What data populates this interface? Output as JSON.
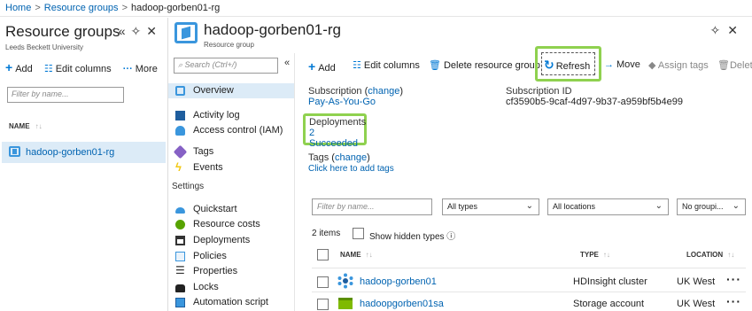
{
  "breadcrumb": {
    "home": "Home",
    "resource_groups": "Resource groups",
    "current": "hadoop-gorben01-rg"
  },
  "left_blade": {
    "title": "Resource groups",
    "subtitle": "Leeds Beckett University",
    "actions": [
      "«",
      "pin-icon",
      "close-icon"
    ],
    "toolbar": {
      "add": "Add",
      "edit_columns": "Edit columns",
      "more": "More"
    },
    "filter_placeholder": "Filter by name...",
    "column_name": "NAME",
    "rows": [
      {
        "name": "hadoop-gorben01-rg"
      }
    ]
  },
  "resource_blade": {
    "title": "hadoop-gorben01-rg",
    "subtitle": "Resource group",
    "search_placeholder": "Search (Ctrl+/)",
    "collapse": "«",
    "menu": [
      {
        "label": "Overview",
        "icon": "resource-group-icon",
        "active": true
      },
      {
        "label": "Activity log",
        "icon": "activity-log-icon"
      },
      {
        "label": "Access control (IAM)",
        "icon": "people-icon"
      },
      {
        "label": "Tags",
        "icon": "tag-icon"
      },
      {
        "label": "Events",
        "icon": "lightning-icon"
      }
    ],
    "settings_header": "Settings",
    "settings_menu": [
      {
        "label": "Quickstart",
        "icon": "cloud-icon"
      },
      {
        "label": "Resource costs",
        "icon": "coin-icon"
      },
      {
        "label": "Deployments",
        "icon": "deployments-icon"
      },
      {
        "label": "Policies",
        "icon": "policy-icon"
      },
      {
        "label": "Properties",
        "icon": "list-icon"
      },
      {
        "label": "Locks",
        "icon": "lock-icon"
      },
      {
        "label": "Automation script",
        "icon": "script-icon"
      }
    ],
    "toolbar": {
      "add": "Add",
      "edit_columns": "Edit columns",
      "delete": "Delete resource group",
      "refresh": "Refresh",
      "move": "Move",
      "assign_tags": "Assign tags",
      "delete_short": "Delete"
    },
    "essentials": {
      "subscription_label": "Subscription",
      "subscription_change": "change",
      "subscription_value": "Pay-As-You-Go",
      "subscription_id_label": "Subscription ID",
      "subscription_id_value": "cf3590b5-9caf-4d97-9b37-a959bf5b4e99",
      "deployments_label": "Deployments",
      "deployments_value": "2 Succeeded",
      "tags_label": "Tags",
      "tags_change": "change",
      "tags_link": "Click here to add tags"
    },
    "resources": {
      "filter_placeholder": "Filter by name...",
      "type_filter": "All types",
      "location_filter": "All locations",
      "grouping": "No groupi...",
      "count_text": "2 items",
      "show_hidden": "Show hidden types",
      "columns": {
        "name": "NAME",
        "type": "TYPE",
        "location": "LOCATION"
      },
      "items": [
        {
          "name": "hadoop-gorben01",
          "type": "HDInsight cluster",
          "location": "UK West",
          "icon": "hdinsight-icon"
        },
        {
          "name": "hadoopgorben01sa",
          "type": "Storage account",
          "location": "UK West",
          "icon": "storage-icon"
        }
      ]
    }
  },
  "colors": {
    "accent": "#0078d4",
    "highlight": "#8fd14f",
    "selected": "#dcebf7"
  }
}
